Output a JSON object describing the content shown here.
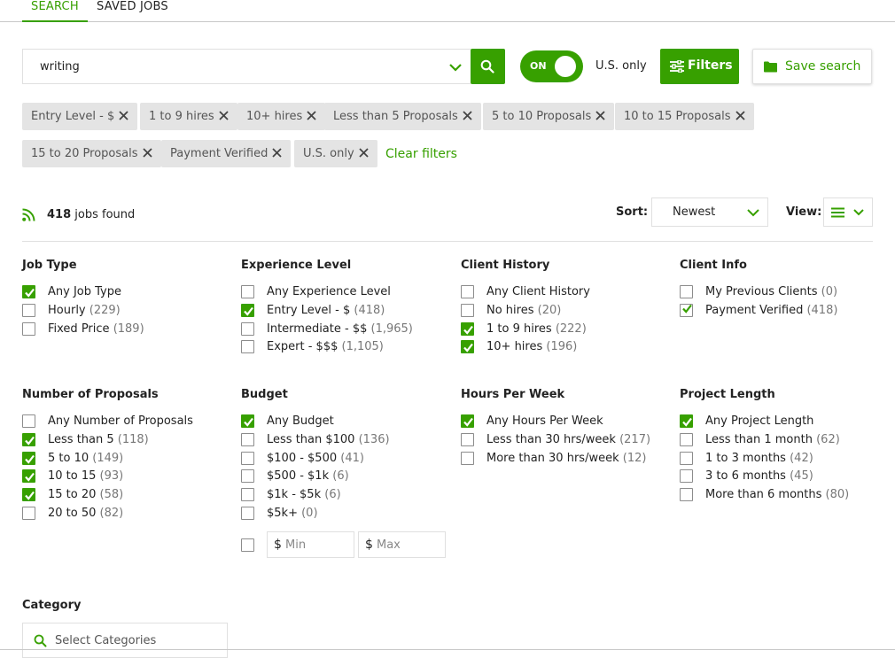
{
  "tabs": [
    {
      "label": "SEARCH",
      "active": true
    },
    {
      "label": "SAVED JOBS",
      "active": false
    }
  ],
  "search": {
    "value": "writing"
  },
  "toggle": {
    "label": "ON",
    "state": true
  },
  "us_only_label": "U.S. only",
  "filters_label": "Filters",
  "save_search_label": "Save search",
  "chips": [
    "Entry Level - $",
    "1 to 9 hires",
    "10+ hires",
    "Less than 5 Proposals",
    "5 to 10 Proposals",
    "10 to 15 Proposals",
    "15 to 20 Proposals",
    "Payment Verified",
    "U.S. only"
  ],
  "clear_filters_label": "Clear filters",
  "results": {
    "count": "418",
    "suffix": "jobs found"
  },
  "sort": {
    "label": "Sort:",
    "value": "Newest"
  },
  "view": {
    "label": "View:"
  },
  "groups": [
    {
      "title": "Job Type",
      "options": [
        {
          "label": "Any Job Type",
          "count": "",
          "checked": true
        },
        {
          "label": "Hourly",
          "count": "(229)",
          "checked": false
        },
        {
          "label": "Fixed Price",
          "count": "(189)",
          "checked": false
        }
      ]
    },
    {
      "title": "Experience Level",
      "options": [
        {
          "label": "Any Experience Level",
          "count": "",
          "checked": false
        },
        {
          "label": "Entry Level - $",
          "count": "(418)",
          "checked": true
        },
        {
          "label": "Intermediate - $$",
          "count": "(1,965)",
          "checked": false
        },
        {
          "label": "Expert - $$$",
          "count": "(1,105)",
          "checked": false
        }
      ]
    },
    {
      "title": "Client History",
      "options": [
        {
          "label": "Any Client History",
          "count": "",
          "checked": false
        },
        {
          "label": "No hires",
          "count": "(20)",
          "checked": false
        },
        {
          "label": "1 to 9 hires",
          "count": "(222)",
          "checked": true
        },
        {
          "label": "10+ hires",
          "count": "(196)",
          "checked": true
        }
      ]
    },
    {
      "title": "Client Info",
      "options": [
        {
          "label": "My Previous Clients",
          "count": "(0)",
          "checked": false
        },
        {
          "label": "Payment Verified",
          "count": "(418)",
          "checked": true
        }
      ]
    },
    {
      "title": "Number of Proposals",
      "options": [
        {
          "label": "Any Number of Proposals",
          "count": "",
          "checked": false
        },
        {
          "label": "Less than 5",
          "count": "(118)",
          "checked": true
        },
        {
          "label": "5 to 10",
          "count": "(149)",
          "checked": true
        },
        {
          "label": "10 to 15",
          "count": "(93)",
          "checked": true
        },
        {
          "label": "15 to 20",
          "count": "(58)",
          "checked": true
        },
        {
          "label": "20 to 50",
          "count": "(82)",
          "checked": false
        }
      ]
    },
    {
      "title": "Budget",
      "options": [
        {
          "label": "Any Budget",
          "count": "",
          "checked": true
        },
        {
          "label": "Less than $100",
          "count": "(136)",
          "checked": false
        },
        {
          "label": "$100 - $500",
          "count": "(41)",
          "checked": false
        },
        {
          "label": "$500 - $1k",
          "count": "(6)",
          "checked": false
        },
        {
          "label": "$1k - $5k",
          "count": "(6)",
          "checked": false
        },
        {
          "label": "$5k+",
          "count": "(0)",
          "checked": false
        }
      ]
    },
    {
      "title": "Hours Per Week",
      "options": [
        {
          "label": "Any Hours Per Week",
          "count": "",
          "checked": true
        },
        {
          "label": "Less than 30 hrs/week",
          "count": "(217)",
          "checked": false
        },
        {
          "label": "More than 30 hrs/week",
          "count": "(12)",
          "checked": false
        }
      ]
    },
    {
      "title": "Project Length",
      "options": [
        {
          "label": "Any Project Length",
          "count": "",
          "checked": true
        },
        {
          "label": "Less than 1 month",
          "count": "(62)",
          "checked": false
        },
        {
          "label": "1 to 3 months",
          "count": "(42)",
          "checked": false
        },
        {
          "label": "3 to 6 months",
          "count": "(45)",
          "checked": false
        },
        {
          "label": "More than 6 months",
          "count": "(80)",
          "checked": false
        }
      ]
    }
  ],
  "budget_custom": {
    "currency": "$",
    "min_placeholder": "Min",
    "max_placeholder": "Max",
    "checked": false
  },
  "category": {
    "title": "Category",
    "placeholder": "Select Categories"
  },
  "colors": {
    "accent": "#37a000",
    "chip_bg": "#e4e4e4",
    "border": "#e0e0e0"
  }
}
